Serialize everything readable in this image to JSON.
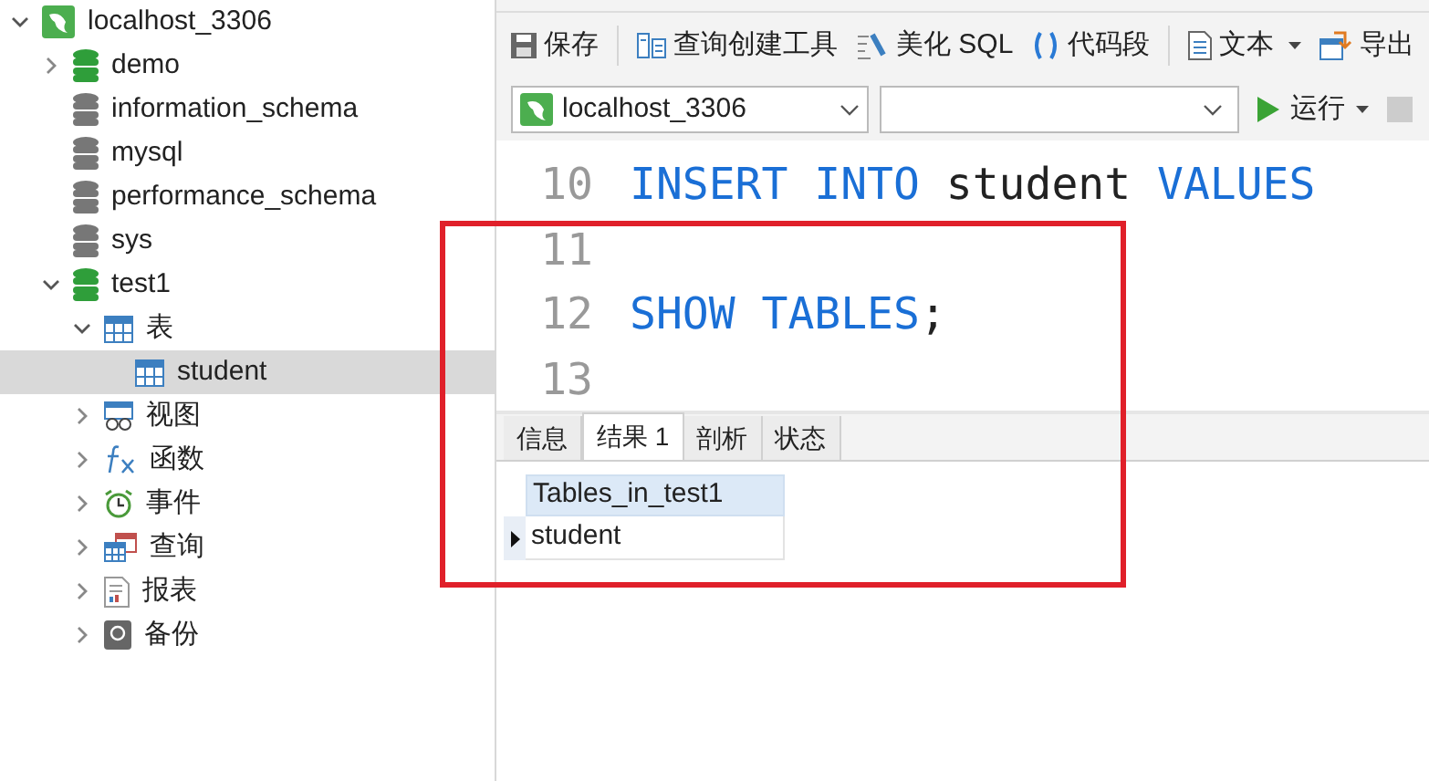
{
  "sidebar": {
    "tree": [
      {
        "label": "localhost_3306",
        "kind": "server",
        "expanded": true,
        "selected": false,
        "children": [
          {
            "label": "demo",
            "kind": "db-open",
            "expanded": false,
            "selected": false
          },
          {
            "label": "information_schema",
            "kind": "db",
            "selected": false
          },
          {
            "label": "mysql",
            "kind": "db",
            "selected": false
          },
          {
            "label": "performance_schema",
            "kind": "db",
            "selected": false
          },
          {
            "label": "sys",
            "kind": "db",
            "selected": false
          },
          {
            "label": "test1",
            "kind": "db-open",
            "expanded": true,
            "selected": false,
            "children": [
              {
                "label": "表",
                "kind": "tables",
                "expanded": true,
                "selected": false,
                "children": [
                  {
                    "label": "student",
                    "kind": "table",
                    "selected": true
                  }
                ]
              },
              {
                "label": "视图",
                "kind": "view",
                "expanded": false,
                "selected": false
              },
              {
                "label": "函数",
                "kind": "function",
                "expanded": false,
                "selected": false
              },
              {
                "label": "事件",
                "kind": "event",
                "expanded": false,
                "selected": false
              },
              {
                "label": "查询",
                "kind": "query",
                "expanded": false,
                "selected": false
              },
              {
                "label": "报表",
                "kind": "report",
                "expanded": false,
                "selected": false
              },
              {
                "label": "备份",
                "kind": "backup",
                "expanded": false,
                "selected": false
              }
            ]
          }
        ]
      }
    ]
  },
  "toolbar": [
    {
      "label": "保存",
      "kind": "save",
      "dropdown": false
    },
    {
      "label": "查询创建工具",
      "kind": "builder",
      "dropdown": false
    },
    {
      "label": "美化 SQL",
      "kind": "beautify",
      "dropdown": false
    },
    {
      "label": "代码段",
      "kind": "snippet",
      "dropdown": false
    },
    {
      "label": "文本",
      "kind": "text",
      "dropdown": true
    },
    {
      "label": "导出",
      "kind": "export",
      "dropdown": false
    }
  ],
  "connection_select": {
    "value": "localhost_3306"
  },
  "run_button": {
    "label": "运行"
  },
  "editor": {
    "lines": [
      {
        "number": "10",
        "tokens": [
          {
            "text": "INSERT",
            "kind": "keyword"
          },
          {
            "text": " INTO",
            "kind": "keyword"
          },
          {
            "text": " student",
            "kind": "plain"
          },
          {
            "text": " VALUES",
            "kind": "keyword"
          }
        ]
      },
      {
        "number": "11"
      },
      {
        "number": "12",
        "tokens": [
          {
            "text": "SHOW",
            "kind": "keyword"
          },
          {
            "text": " TABLES",
            "kind": "keyword"
          },
          {
            "text": ";",
            "kind": "plain"
          }
        ]
      },
      {
        "number": "13"
      }
    ]
  },
  "result_tabs": [
    {
      "label": "信息",
      "selected": false
    },
    {
      "label": "结果 1",
      "selected": true
    },
    {
      "label": "剖析",
      "selected": false
    },
    {
      "label": "状态",
      "selected": false
    }
  ],
  "result_grid": {
    "columns": [
      "Tables_in_test1"
    ],
    "rows": [
      {
        "cells": [
          "student"
        ],
        "current": true
      }
    ]
  }
}
